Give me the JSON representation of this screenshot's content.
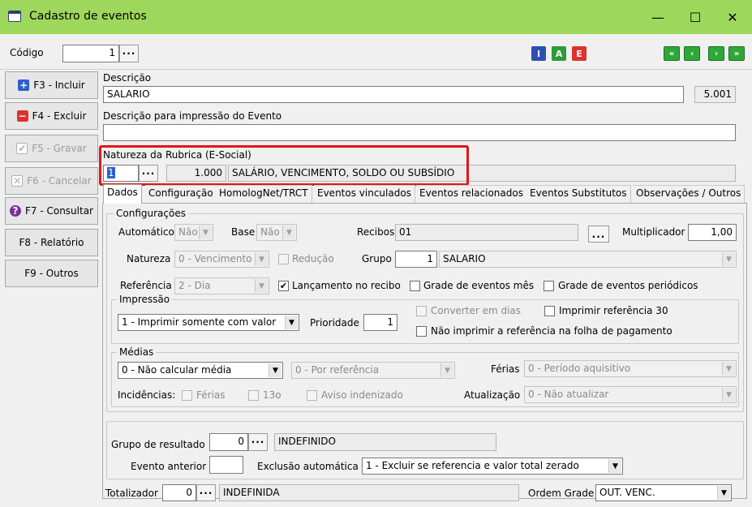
{
  "window": {
    "title": "Cadastro de eventos",
    "minimize": "—",
    "maximize": "☐",
    "close": "✕"
  },
  "header": {
    "codigo_label": "Código",
    "codigo_value": "1",
    "dots": "···",
    "toolbar": {
      "i": "I",
      "a": "A",
      "e": "E"
    },
    "nav": {
      "first": "«",
      "prev": "‹",
      "next": "›",
      "last": "»"
    }
  },
  "sidebar": {
    "incluir": "F3 - Incluir",
    "excluir": "F4 - Excluir",
    "gravar": "F5 - Gravar",
    "cancelar": "F6 - Cancelar",
    "consultar": "F7 - Consultar",
    "relatorio": "F8 - Relatório",
    "outros": "F9 - Outros"
  },
  "form": {
    "descricao_label": "Descrição",
    "descricao_value": "SALARIO",
    "descricao_num": "5.001",
    "impressao_label": "Descrição para impressão do Evento",
    "impressao_value": "",
    "natureza_label": "Natureza da Rubrica (E-Social)",
    "natureza_code": "1",
    "natureza_num": "1.000",
    "natureza_desc": "SALÁRIO, VENCIMENTO, SOLDO OU SUBSÍDIO"
  },
  "tabs": [
    "Dados",
    "Configuração",
    "HomologNet/TRCT",
    "Eventos vinculados",
    "Eventos relacionados",
    "Eventos Substitutos",
    "Observações / Outros"
  ],
  "config": {
    "title": "Configurações",
    "automatico_label": "Automático",
    "automatico_value": "Não",
    "base_label": "Base",
    "base_value": "Não",
    "recibos_label": "Recibos",
    "recibos_value": "01",
    "recibos_btn": "...",
    "multiplicador_label": "Multiplicador",
    "multiplicador_value": "1,00",
    "natureza_label": "Natureza",
    "natureza_value": "0 - Vencimento",
    "reducao_label": "Redução",
    "grupo_label": "Grupo",
    "grupo_num": "1",
    "grupo_value": "SALARIO",
    "referencia_label": "Referência",
    "referencia_value": "2 - Dia",
    "lanc_label": "Lançamento no recibo",
    "grade_mes_label": "Grade de eventos mês",
    "grade_per_label": "Grade de eventos periódicos"
  },
  "impressao": {
    "title": "Impressão",
    "value": "1 - Imprimir somente com valor",
    "prioridade_label": "Prioridade",
    "prioridade_value": "1",
    "converter_label": "Converter em dias",
    "imprimir_ref_label": "Imprimir referência 30",
    "nao_imprimir_label": "Não imprimir a referência na folha de pagamento"
  },
  "medias": {
    "title": "Médias",
    "calc_value": "0 - Não calcular média",
    "ref_value": "0 - Por referência",
    "ferias_label": "Férias",
    "ferias_value": "0 - Período aquisitivo",
    "incid_label": "Incidências:",
    "inc_ferias": "Férias",
    "inc_13": "13o",
    "inc_aviso": "Aviso indenizado",
    "atual_label": "Atualização",
    "atual_value": "0 - Não atualizar"
  },
  "resultado": {
    "grupo_label": "Grupo de resultado",
    "grupo_num": "0",
    "grupo_desc": "INDEFINIDO",
    "anterior_label": "Evento anterior",
    "anterior_value": "",
    "exclusao_label": "Exclusão automática",
    "exclusao_value": "1 - Excluir se referencia e valor total zerado"
  },
  "footer": {
    "totalizador_label": "Totalizador",
    "totalizador_num": "0",
    "totalizador_desc": "INDEFINIDA",
    "ordem_label": "Ordem Grade",
    "ordem_value": "OUT. VENC."
  },
  "glyphs": {
    "check": "✔",
    "down": "▼"
  }
}
